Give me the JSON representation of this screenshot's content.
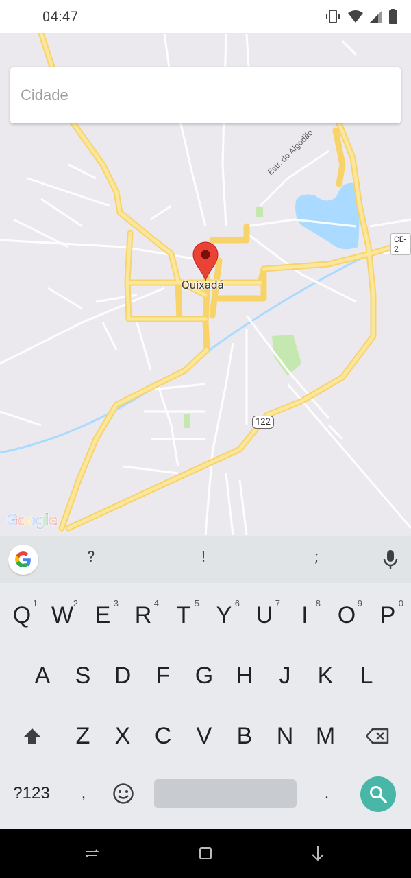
{
  "status_bar": {
    "time": "04:47",
    "icons": [
      "vibrate-icon",
      "wifi-icon",
      "signal-icon",
      "battery-icon"
    ]
  },
  "search": {
    "placeholder": "Cidade",
    "value": ""
  },
  "map": {
    "city_label": "Quixadá",
    "road_label": "Estr. do Algodão",
    "badge_ce": "CE-2",
    "badge_highway": "122",
    "logo_text": "Google",
    "colors": {
      "background": "#ece9ee",
      "road_major": "#fbe08b",
      "road_minor": "#ffffff",
      "water": "#aadaff",
      "park": "#c5e8b0",
      "pin": "#ea4335"
    }
  },
  "keyboard": {
    "suggestions": [
      "?",
      "!",
      ";"
    ],
    "row1": [
      "Q",
      "W",
      "E",
      "R",
      "T",
      "Y",
      "U",
      "I",
      "O",
      "P"
    ],
    "row1_hints": [
      "1",
      "2",
      "3",
      "4",
      "5",
      "6",
      "7",
      "8",
      "9",
      "0"
    ],
    "row2": [
      "A",
      "S",
      "D",
      "F",
      "G",
      "H",
      "J",
      "K",
      "L"
    ],
    "row3": [
      "Z",
      "X",
      "C",
      "V",
      "B",
      "N",
      "M"
    ],
    "symbols_key": "?123",
    "comma_key": ",",
    "period_key": ".",
    "accent_color": "#48b7a8"
  }
}
